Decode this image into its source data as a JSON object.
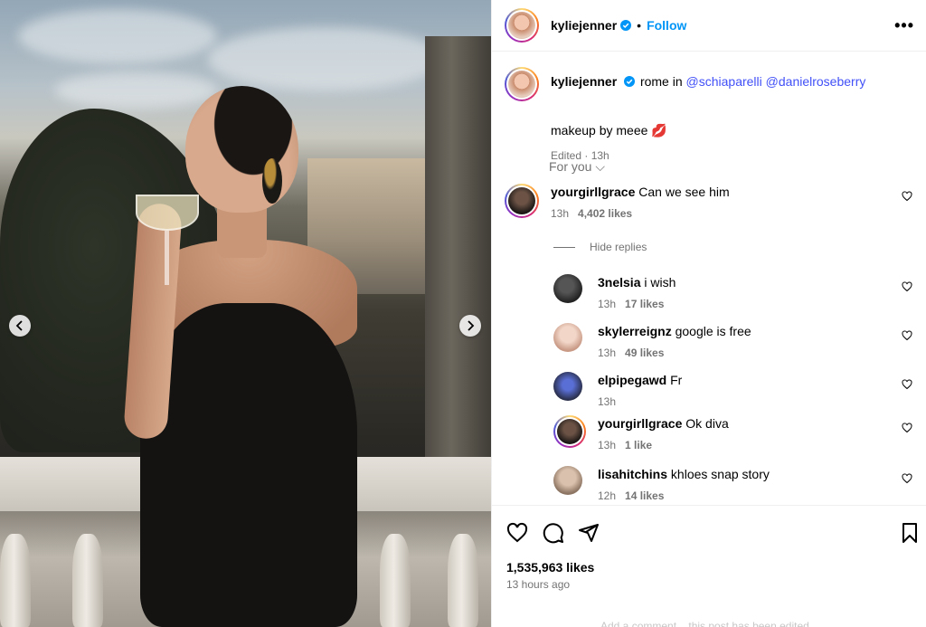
{
  "post": {
    "username": "kyliejenner",
    "follow_label": "Follow",
    "separator": "•",
    "more_label": "•••"
  },
  "caption": {
    "username": "kyliejenner",
    "text_prefix": "rome in ",
    "mention1": "@schiaparelli",
    "mention2": "@danielroseberry",
    "line2": "makeup by meee 💋",
    "meta": "Edited · 13h"
  },
  "sort": {
    "label": "For you ⌵"
  },
  "comments": [
    {
      "username": "yourgirllgrace",
      "text": "Can we see him",
      "time": "13h",
      "likes": "4,402 likes"
    }
  ],
  "hide_replies": "Hide replies",
  "replies": [
    {
      "username": "3nelsia",
      "text": "i wish",
      "time": "13h",
      "likes": "17 likes"
    },
    {
      "username": "skylerreignz",
      "text": "google is free",
      "time": "13h",
      "likes": "49 likes"
    },
    {
      "username": "elpipegawd",
      "text": "Fr",
      "time": "13h",
      "likes": ""
    },
    {
      "username": "yourgirllgrace",
      "text": "Ok diva",
      "time": "13h",
      "likes": "1 like"
    },
    {
      "username": "lisahitchins",
      "text": "khloes snap story",
      "time": "12h",
      "likes": "14 likes"
    }
  ],
  "footer": {
    "likes_total": "1,535,963 likes",
    "time_ago": "13 hours ago",
    "partial_text": "Add a comment... this post has been edited"
  },
  "colors": {
    "accent": "#0095f6",
    "mention": "#4150f7",
    "muted": "#737373"
  }
}
